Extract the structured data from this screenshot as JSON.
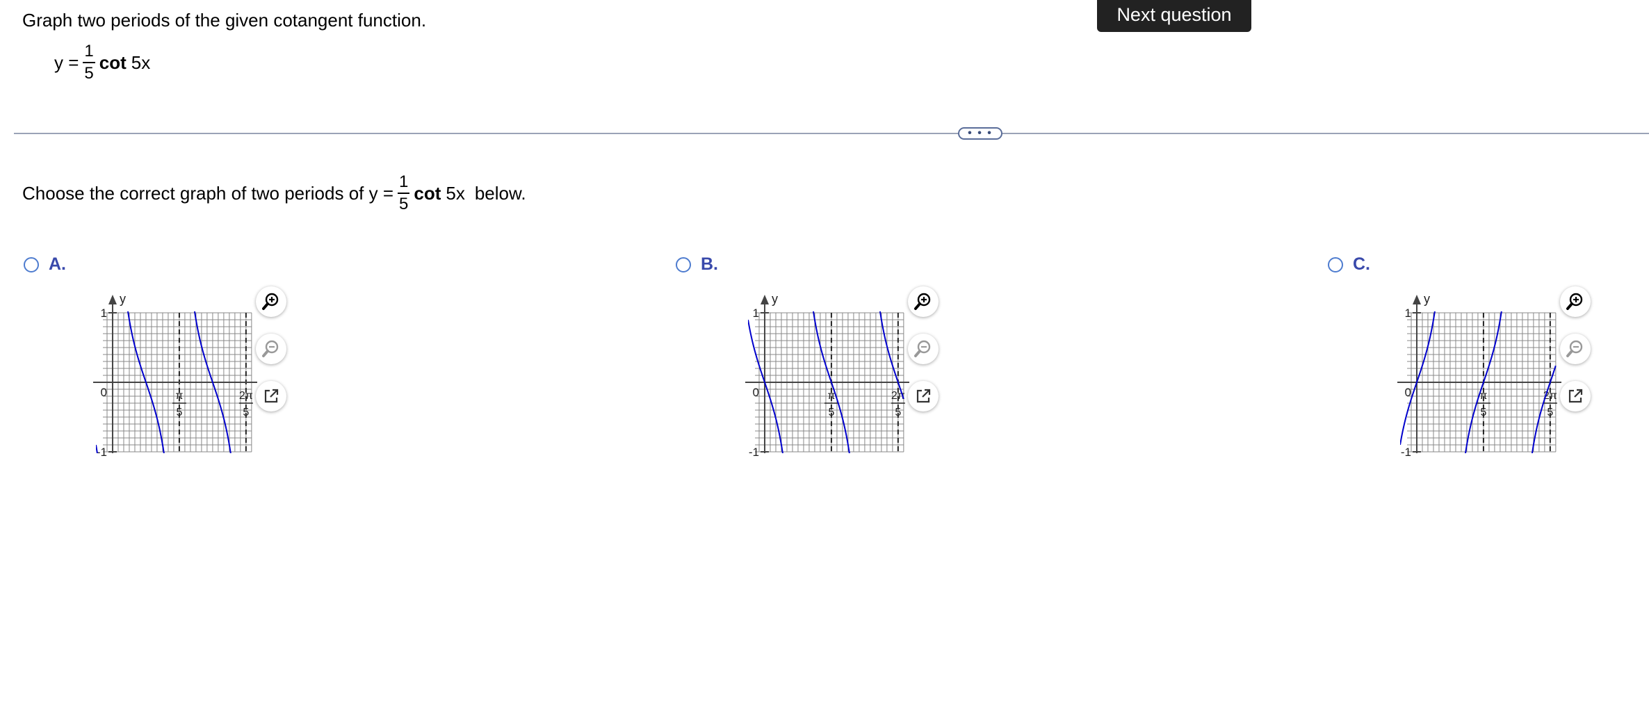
{
  "header": {
    "prompt": "Graph two periods of the given cotangent function.",
    "next_label": "Next question"
  },
  "equation": {
    "lhs": "y =",
    "numerator": "1",
    "denominator": "5",
    "func": "cot",
    "arg": "5x"
  },
  "question": {
    "before": "Choose the correct graph of two periods of y =",
    "numerator": "1",
    "denominator": "5",
    "func": "cot",
    "arg": "5x",
    "after": "below."
  },
  "divider": {
    "more_label": "• • •"
  },
  "options": [
    {
      "letter": "A.",
      "selected": false
    },
    {
      "letter": "B.",
      "selected": false
    },
    {
      "letter": "C.",
      "selected": false
    }
  ],
  "chart_data": [
    {
      "type": "line",
      "option": "A",
      "function": "1/5 cot(5x) (vertically scaled)",
      "sign": 1,
      "shift": 0,
      "xlim": [
        -0.157,
        1.31
      ],
      "ylim": [
        -1,
        1
      ],
      "xlabel": "x",
      "ylabel": "y",
      "x_ticks": [
        {
          "label": "π/5",
          "value": 0.6283
        },
        {
          "label": "2π/5",
          "value": 1.2566
        }
      ],
      "y_ticks": [
        {
          "label": "1",
          "value": 1
        },
        {
          "label": "0",
          "value": 0
        },
        {
          "label": "-1",
          "value": -1
        }
      ],
      "asymptotes": [
        0,
        0.6283,
        1.2566
      ],
      "grid": true
    },
    {
      "type": "line",
      "option": "B",
      "function": "1/5 cot(5x) shifted right by π/10",
      "sign": 1,
      "shift": 0.31416,
      "xlim": [
        -0.157,
        1.31
      ],
      "ylim": [
        -1,
        1
      ],
      "xlabel": "x",
      "ylabel": "y",
      "x_ticks": [
        {
          "label": "π/5",
          "value": 0.6283
        },
        {
          "label": "2π/5",
          "value": 1.2566
        }
      ],
      "y_ticks": [
        {
          "label": "1",
          "value": 1
        },
        {
          "label": "0",
          "value": 0
        },
        {
          "label": "-1",
          "value": -1
        }
      ],
      "asymptotes": [
        0.3142,
        0.9425
      ],
      "grid": true
    },
    {
      "type": "line",
      "option": "C",
      "function": "-1/5 cot(5x) shifted right by π/10",
      "sign": -1,
      "shift": 0.31416,
      "xlim": [
        -0.157,
        1.31
      ],
      "ylim": [
        -1,
        1
      ],
      "xlabel": "x",
      "ylabel": "y",
      "x_ticks": [
        {
          "label": "π/5",
          "value": 0.6283
        },
        {
          "label": "2π/5",
          "value": 1.2566
        }
      ],
      "y_ticks": [
        {
          "label": "1",
          "value": 1
        },
        {
          "label": "0",
          "value": 0
        },
        {
          "label": "-1",
          "value": -1
        }
      ],
      "asymptotes": [
        0.3142,
        0.9425
      ],
      "grid": true
    }
  ],
  "colors": {
    "curve": "#0000cc",
    "grid": "#888888",
    "option_letter": "#3949ab",
    "radio": "#4e7ccf",
    "pill": "#5a6d99"
  },
  "icons": {
    "zoom_in": "zoom-in-icon",
    "zoom_out": "zoom-out-icon",
    "popout": "popout-icon"
  }
}
